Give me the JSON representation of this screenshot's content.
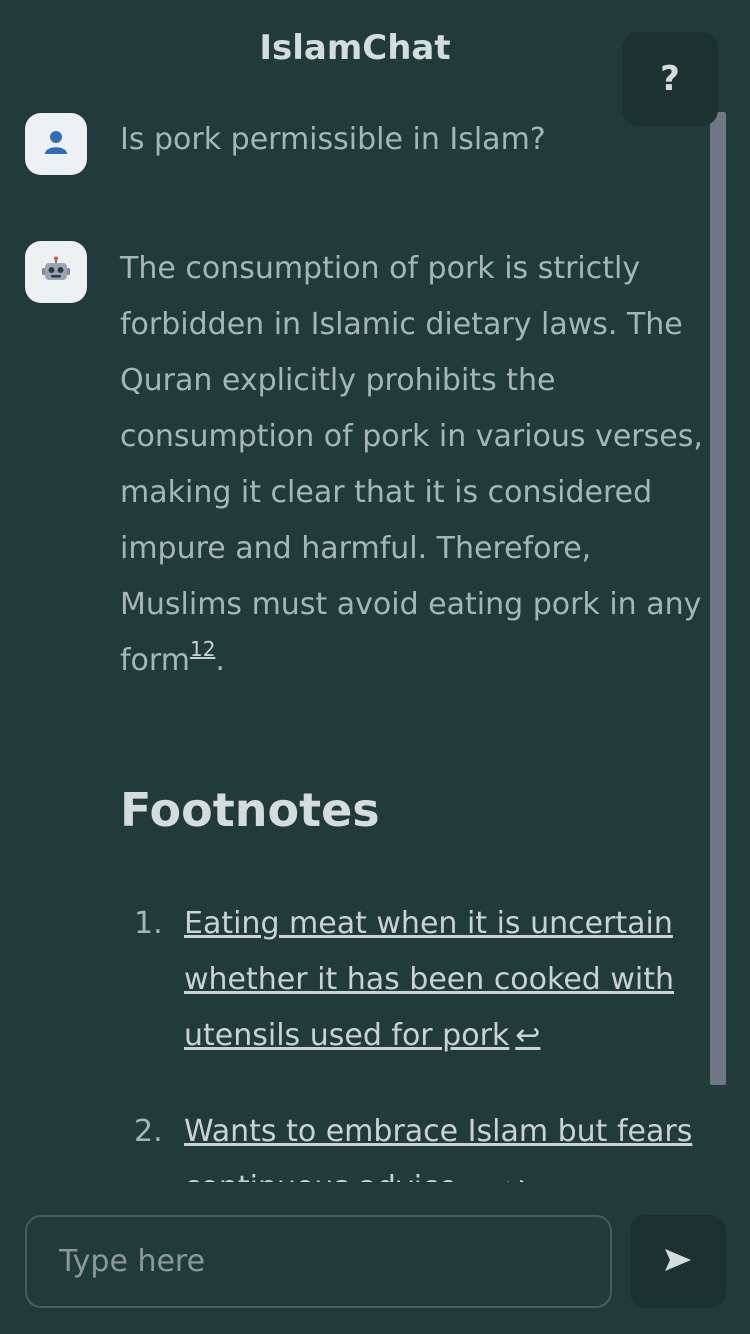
{
  "header": {
    "title": "IslamChat",
    "help_label": "?"
  },
  "chat": {
    "user_avatar_icon": "user-icon",
    "bot_avatar_icon": "robot-icon",
    "user_message": "Is pork permissible in Islam?",
    "bot_message": "The consumption of pork is strictly forbidden in Islamic dietary laws. The Quran explicitly prohibits the consumption of pork in various verses, making it clear that it is considered impure and harmful. Therefore, Muslims must avoid eating pork in any form",
    "footnote_ref_1": "1",
    "footnote_ref_2": "2",
    "bot_message_end": "."
  },
  "footnotes": {
    "title": "Footnotes",
    "items": [
      {
        "number": "1.",
        "text": "Eating meat when it is uncertain whether it has been cooked with utensils used for pork",
        "back": "↩"
      },
      {
        "number": "2.",
        "text": "Wants to embrace Islam but fears continuous advice ...",
        "back": "↩"
      }
    ]
  },
  "composer": {
    "placeholder": "Type here",
    "send_icon": "send-icon"
  },
  "colors": {
    "background": "#213a3a",
    "panel": "#1b3231",
    "text": "#a5b7b5",
    "heading": "#d5dddc",
    "scrollbar": "#707785"
  }
}
